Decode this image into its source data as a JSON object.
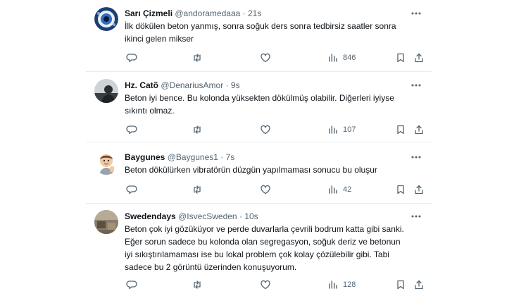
{
  "tweets": [
    {
      "name": "Sarı Çizmeli",
      "handle": "@andoramedaaa",
      "time": "21s",
      "lines": [
        "İlk dökülen beton yanmış, sonra soğuk ders sonra tedbirsiz saatler sonra",
        "ikinci gelen mikser"
      ],
      "views": "846"
    },
    {
      "name": "Hz. Catõ",
      "handle": "@DenariusAmor",
      "time": "9s",
      "lines": [
        "Beton iyi bence.  Bu kolonda yüksekten dökülmüş olabilir. Diğerleri iyiyse",
        "sıkıntı olmaz."
      ],
      "views": "107"
    },
    {
      "name": "Baygunes",
      "handle": "@Baygunes1",
      "time": "7s",
      "lines": [
        "Beton dökülürken vibratörün düzgün yapılmaması sonucu bu oluşur"
      ],
      "views": "42"
    },
    {
      "name": "Swedendays",
      "handle": "@IsvecSweden",
      "time": "10s",
      "lines": [
        "Beton çok iyi gözüküyor ve perde duvarlarla çevrili bodrum katta gibi sanki.",
        "Eğer sorun sadece bu kolonda olan segregasyon, soğuk deriz ve betonun",
        "iyi sıkıştırılamaması ise bu lokal problem çok kolay çözülebilir gibi. Tabi",
        "sadece bu 2 görüntü üzerinden konuşuyorum."
      ],
      "views": "128"
    }
  ],
  "separator": "·",
  "colors": {
    "text": "#0f1419",
    "secondary": "#536471",
    "border": "#e6ecf0"
  },
  "icons": [
    "reply-icon",
    "retweet-icon",
    "like-icon",
    "views-icon",
    "bookmark-icon",
    "share-icon",
    "more-icon"
  ]
}
